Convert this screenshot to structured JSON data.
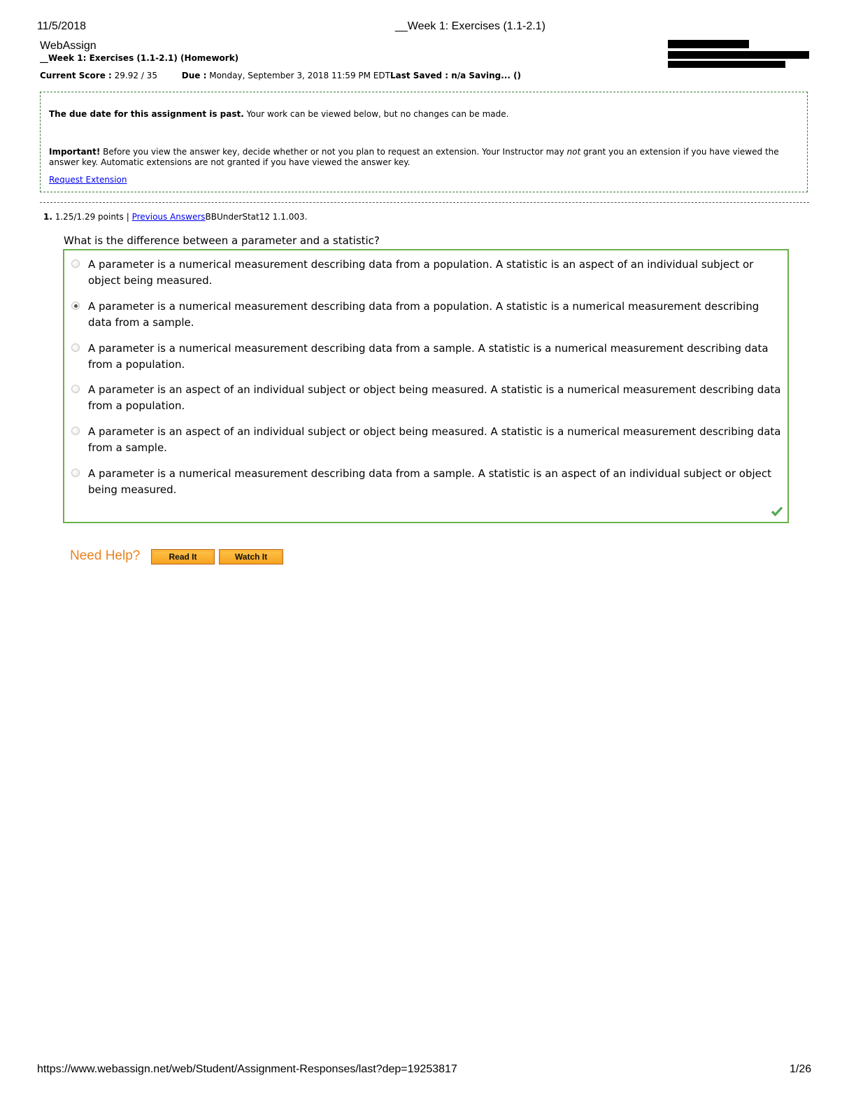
{
  "print_header": {
    "date": "11/5/2018",
    "page_title": "__Week 1: Exercises (1.1-2.1)"
  },
  "brand": "WebAssign",
  "assignment": {
    "title": "__Week 1: Exercises (1.1-2.1) (Homework)",
    "score_label": "Current Score :",
    "score_value": "29.92 / 35",
    "due_label": "Due :",
    "due_value": "Monday, September 3, 2018 11:59 PM EDT",
    "saved_label": "Last Saved : n/a Saving...  ()"
  },
  "notice": {
    "past_bold": "The due date for this assignment is past.",
    "past_text": " Your work can be viewed below, but no changes can be made.",
    "important_bold": "Important!",
    "important_text_1": " Before you view the answer key, decide whether or not you plan to request an extension. Your Instructor may ",
    "important_em": "not",
    "important_text_2": " grant you an extension if you have viewed the answer key. Automatic extensions are not granted if you have viewed the answer key.",
    "request_link": "Request Extension"
  },
  "question": {
    "number": "1.",
    "points": " 1.25/1.29 points | ",
    "previous_answers_link": "Previous Answers",
    "source": "BBUnderStat12 1.1.003.",
    "prompt": "What is the difference between a parameter and a statistic?",
    "options": [
      {
        "text": "A parameter is a numerical measurement describing data from a population. A statistic is an aspect of an individual subject or object being measured.",
        "selected": false
      },
      {
        "text": "A parameter is a numerical measurement describing data from a population. A statistic is a numerical measurement describing data from a sample.",
        "selected": true
      },
      {
        "text": "A parameter is a numerical measurement describing data from a sample. A statistic is a numerical measurement describing data from a population.",
        "selected": false
      },
      {
        "text": "A parameter is an aspect of an individual subject or object being measured. A statistic is a numerical measurement describing data from a population.",
        "selected": false
      },
      {
        "text": "A parameter is an aspect of an individual subject or object being measured. A statistic is a numerical measurement describing data from a sample.",
        "selected": false
      },
      {
        "text": "A parameter is a numerical measurement describing data from a sample. A statistic is an aspect of an individual subject or object being measured.",
        "selected": false
      }
    ],
    "result_icon": "check-icon"
  },
  "help": {
    "label": "Need Help?",
    "read_button": "Read It",
    "watch_button": "Watch It"
  },
  "print_footer": {
    "url": "https://www.webassign.net/web/Student/Assignment-Responses/last?dep=19253817",
    "page": "1/26"
  },
  "colors": {
    "accent_green": "#6ab24a",
    "notice_border": "#3a7a35",
    "help_orange": "#e8821e",
    "button_fill": "#f6a321",
    "link_blue": "#0000ee"
  }
}
